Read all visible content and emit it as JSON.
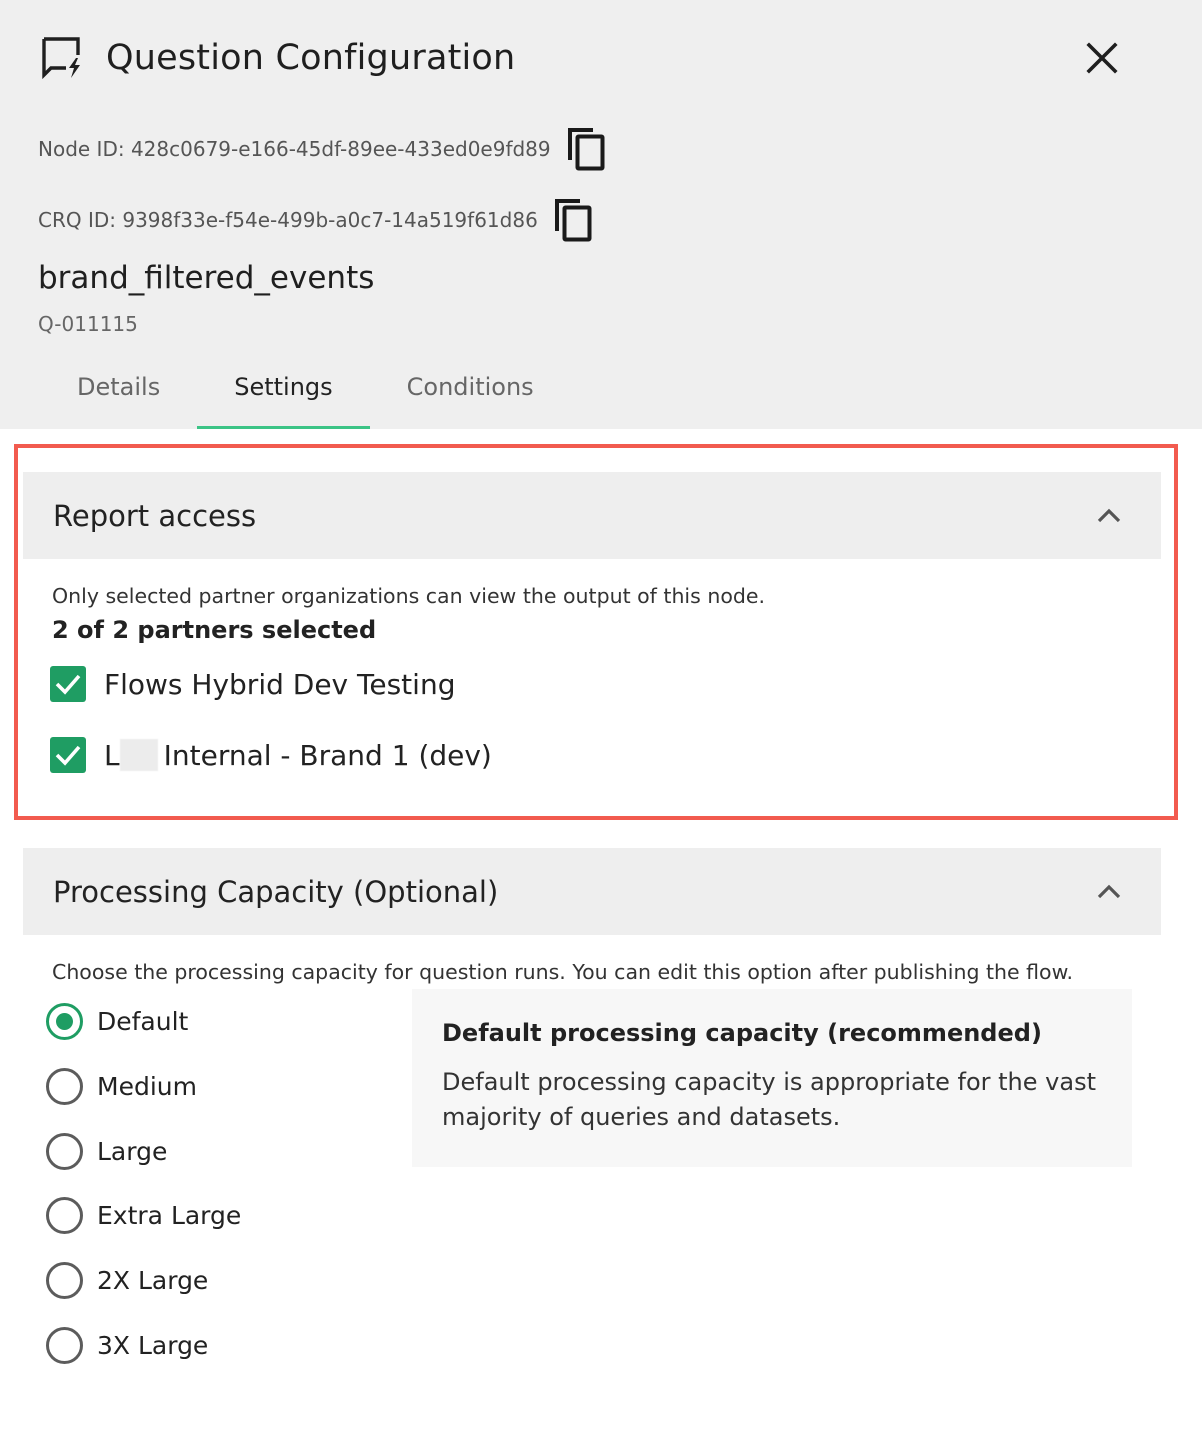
{
  "panel": {
    "title": "Question Configuration",
    "node_id": "Node ID: 428c0679-e166-45df-89ee-433ed0e9fd89",
    "crq_id": "CRQ ID: 9398f33e-f54e-499b-a0c7-14a519f61d86",
    "question_name": "brand_filtered_events",
    "question_code": "Q-011115"
  },
  "tabs": [
    {
      "label": "Details",
      "active": false
    },
    {
      "label": "Settings",
      "active": true
    },
    {
      "label": "Conditions",
      "active": false
    }
  ],
  "report_access": {
    "title": "Report access",
    "description": "Only selected partner organizations can view the output of this node.",
    "selected_count": "2 of 2 partners selected",
    "partners": [
      {
        "label": "Flows Hybrid Dev Testing",
        "checked": true
      },
      {
        "label_prefix": "L",
        "label_suffix": "Internal - Brand 1 (dev)",
        "checked": true
      }
    ]
  },
  "processing_capacity": {
    "title": "Processing Capacity (Optional)",
    "description": "Choose the processing capacity for question runs. You can edit this option after publishing the flow.",
    "options": [
      {
        "label": "Default",
        "selected": true
      },
      {
        "label": "Medium",
        "selected": false
      },
      {
        "label": "Large",
        "selected": false
      },
      {
        "label": "Extra Large",
        "selected": false
      },
      {
        "label": "2X Large",
        "selected": false
      },
      {
        "label": "3X Large",
        "selected": false
      }
    ],
    "info": {
      "title": "Default processing capacity (recommended)",
      "body": "Default processing capacity is appropriate for the vast majority of queries and datasets."
    }
  },
  "colors": {
    "accent": "#1f9d63",
    "tab_underline": "#3cc486",
    "highlight_border": "#f25b4f",
    "header_bg": "#efefef"
  },
  "icons": {
    "title": "chat-bolt-icon",
    "close": "close-icon",
    "copy": "copy-icon",
    "collapse": "chevron-up-icon",
    "check": "checkmark-icon"
  }
}
